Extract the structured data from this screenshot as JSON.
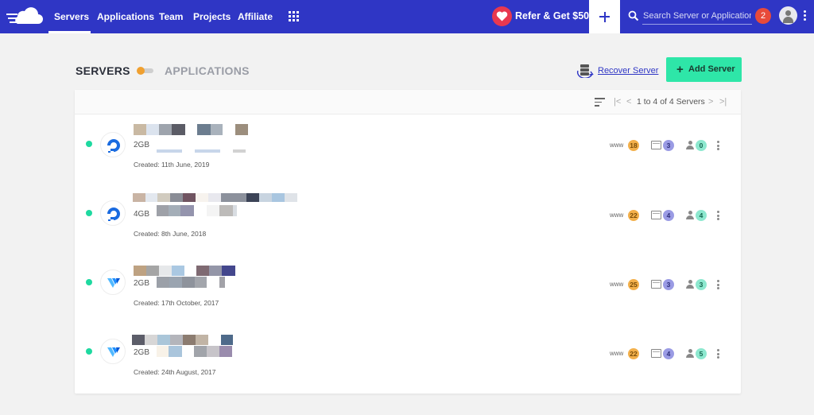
{
  "nav": {
    "items": [
      "Servers",
      "Applications",
      "Team",
      "Projects",
      "Affiliate"
    ],
    "refer_label": "Refer & Get $50",
    "search_placeholder": "Search Server or Application",
    "notification_count": "2"
  },
  "page": {
    "servers_heading": "SERVERS",
    "applications_heading": "APPLICATIONS",
    "recover_label": "Recover Server",
    "add_server_label": "Add Server",
    "add_server_icon": "+"
  },
  "table": {
    "pagination": "1 to 4 of 4 Servers",
    "rows": [
      {
        "provider": "digitalocean",
        "size": "2GB",
        "created": "Created: 11th June, 2019",
        "www": "www",
        "apps": "18",
        "projects": "3",
        "members": "0"
      },
      {
        "provider": "digitalocean",
        "size": "4GB",
        "created": "Created: 8th June, 2018",
        "www": "www",
        "apps": "22",
        "projects": "4",
        "members": "4"
      },
      {
        "provider": "vultr",
        "size": "2GB",
        "created": "Created: 17th October, 2017",
        "www": "www",
        "apps": "25",
        "projects": "3",
        "members": "3"
      },
      {
        "provider": "vultr",
        "size": "2GB",
        "created": "Created: 24th August, 2017",
        "www": "www",
        "apps": "22",
        "projects": "4",
        "members": "5"
      }
    ]
  },
  "colors": {
    "topbar": "#2f36c5",
    "accent_green": "#2ee6a8",
    "status_online": "#1ed9a0",
    "badge_orange": "#f3b04b",
    "badge_purple": "#9a9be4",
    "badge_green": "#8de8cf"
  },
  "icons": [
    "cloudways-logo-icon",
    "apps-grid-icon",
    "heart-icon",
    "plus-icon",
    "search-icon",
    "user-avatar-icon",
    "kebab-menu-icon",
    "server-recover-icon",
    "sort-icon",
    "first-page-icon",
    "prev-page-icon",
    "next-page-icon",
    "last-page-icon",
    "digitalocean-icon",
    "vultr-icon",
    "folder-icon",
    "person-icon"
  ]
}
